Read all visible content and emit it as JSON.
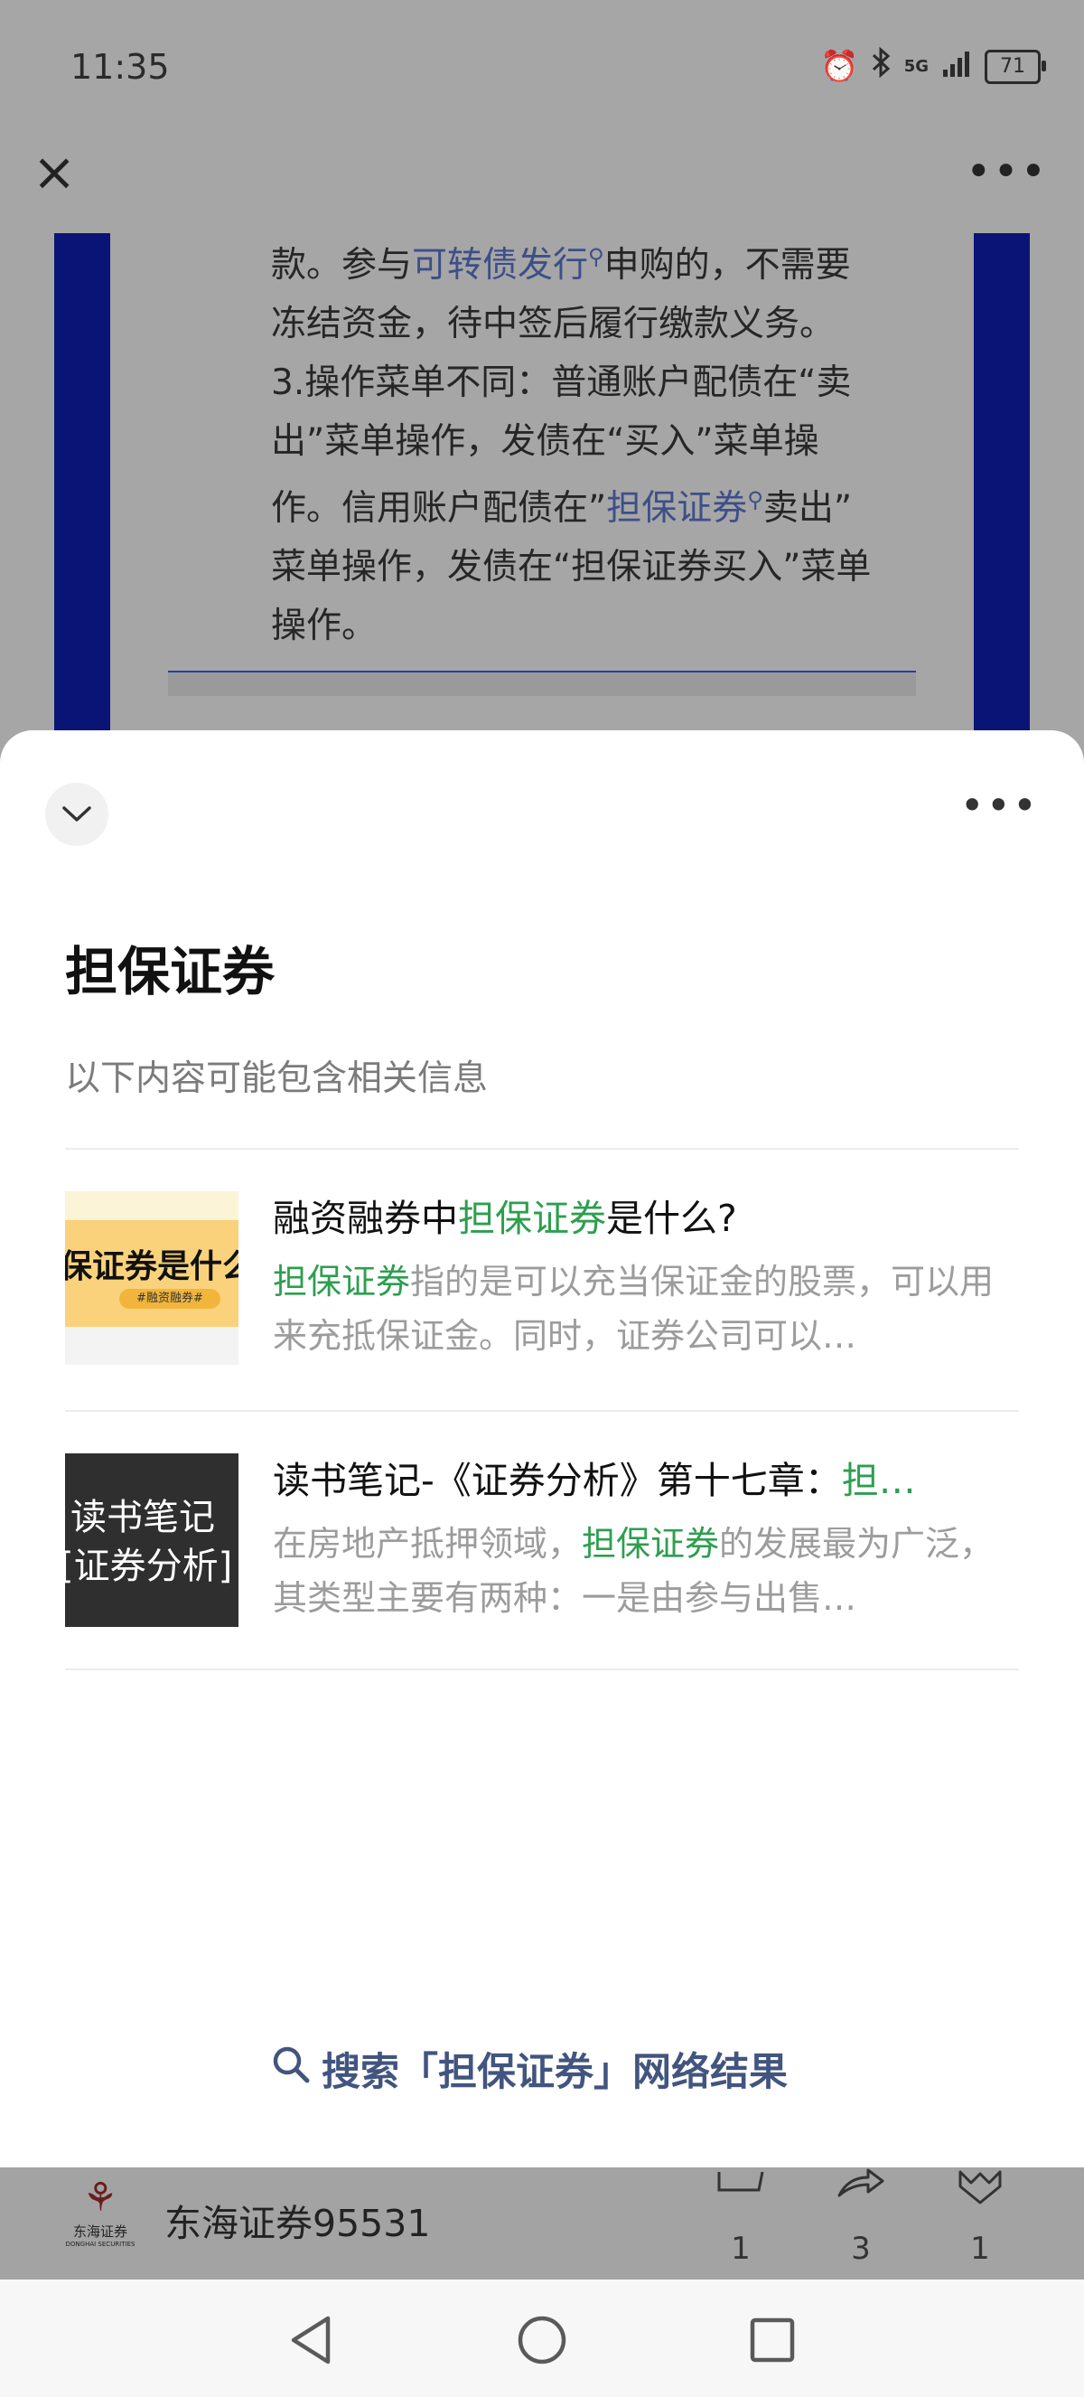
{
  "status_bar": {
    "time": "11:35",
    "network": "5G",
    "battery": "71",
    "icons": [
      "alarm-icon",
      "bluetooth-icon",
      "signal-icon",
      "battery-icon"
    ]
  },
  "top_bar": {
    "close_icon": "close-icon",
    "more_icon": "more-icon"
  },
  "article": {
    "line1_pre": "款。参与",
    "line1_link": "可转债发行",
    "line1_post": "申购的，不需要",
    "line2": "冻结资金，待中签后履行缴款义务。",
    "line3": "3.操作菜单不同：普通账户配债在“卖",
    "line4": "出”菜单操作，发债在“买入”菜单操",
    "line5_pre": "作。信用账户配债在”",
    "line5_link": "担保证券",
    "line5_post": "卖出”",
    "line6": "菜单操作，发债在“担保证券买入”菜单",
    "line7": "操作。"
  },
  "sheet": {
    "title": "担保证券",
    "subtitle": "以下内容可能包含相关信息",
    "results": [
      {
        "title_pre": "融资融券中",
        "title_hl": "担保证券",
        "title_post": "是什么?",
        "snippet_hl": "担保证券",
        "snippet_rest": "指的是可以充当保证金的股票，可以用来充抵保证金。同时，证券公司可以…",
        "thumb_text": "保证券是什么",
        "thumb_tag": "#融资融券#"
      },
      {
        "title_pre": "读书笔记-《证券分析》第十七章：",
        "title_hl": "担…",
        "snippet_pre": "在房地产抵押领域，",
        "snippet_hl": "担保证券",
        "snippet_rest": "的发展最为广泛，其类型主要有两种：一是由参与出售…",
        "thumb_line1": "读书笔记",
        "thumb_line2": "证券分析"
      }
    ],
    "web_search": "搜索「担保证券」网络结果"
  },
  "account": {
    "name": "东海证券95531",
    "logo_cn": "东海证券",
    "logo_en": "DONGHAI SECURITIES",
    "stats": [
      {
        "icon": "like-icon",
        "count": "1"
      },
      {
        "icon": "share-icon",
        "count": "3"
      },
      {
        "icon": "favorite-icon",
        "count": "1"
      }
    ]
  },
  "colors": {
    "highlight": "#2e9e4f",
    "link": "#42557f",
    "article_frame": "#0a1476"
  }
}
